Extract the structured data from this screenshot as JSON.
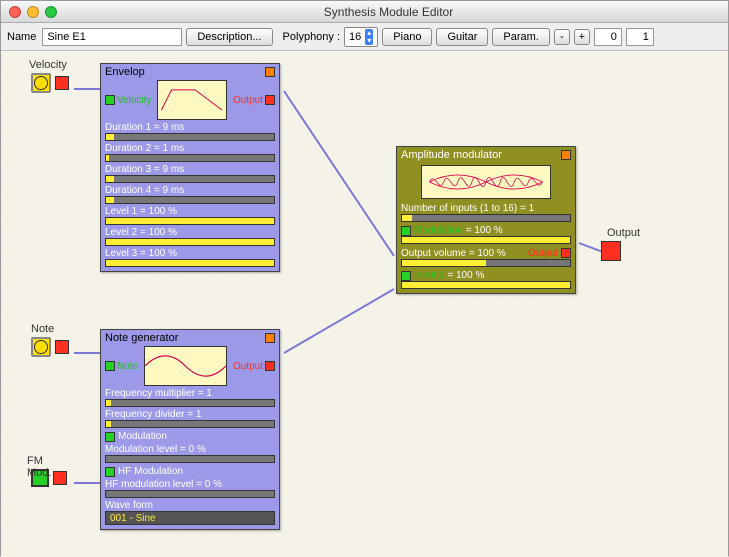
{
  "window": {
    "title": "Synthesis Module Editor"
  },
  "toolbar": {
    "name_label": "Name",
    "name_value": "Sine E1",
    "description_btn": "Description...",
    "polyphony_label": "Polyphony :",
    "polyphony_value": "16",
    "piano_btn": "Piano",
    "guitar_btn": "Guitar",
    "param_btn": "Param.",
    "minus": "-",
    "plus": "+",
    "num1": "0",
    "num2": "1"
  },
  "external": {
    "velocity": "Velocity",
    "note": "Note",
    "fm_mod": "FM Mod.",
    "output": "Output"
  },
  "envelop": {
    "title": "Envelop",
    "input_label": "Velocity",
    "output_label": "Output",
    "params": [
      {
        "label": "Duration 1 = 9 ms",
        "fill": 5
      },
      {
        "label": "Duration 2 = 1 ms",
        "fill": 2
      },
      {
        "label": "Duration 3 = 9 ms",
        "fill": 5
      },
      {
        "label": "Duration 4 = 9 ms",
        "fill": 5
      },
      {
        "label": "Level 1 = 100 %",
        "fill": 100
      },
      {
        "label": "Level 2 = 100 %",
        "fill": 100
      },
      {
        "label": "Level 3 = 100 %",
        "fill": 100
      }
    ]
  },
  "notegen": {
    "title": "Note generator",
    "input_label": "Note",
    "output_label": "Output",
    "freq_mult": "Frequency multiplier = 1",
    "freq_div": "Frequency divider = 1",
    "modulation_label": "Modulation",
    "mod_level": "Modulation level = 0 %",
    "hf_mod_label": "HF Modulation",
    "hf_level": "HF modulation level = 0 %",
    "waveform_label": "Wave form",
    "waveform": "001 - Sine"
  },
  "ampmod": {
    "title": "Amplitude modulator",
    "num_inputs": "Number of inputs (1 to 16) = 1",
    "modulation_label": "Modulation",
    "modulation_val": " = 100 %",
    "output_vol": "Output volume = 100 %",
    "output_label": "Output",
    "input1_label": "Input 1",
    "input1_val": " = 100 %"
  }
}
